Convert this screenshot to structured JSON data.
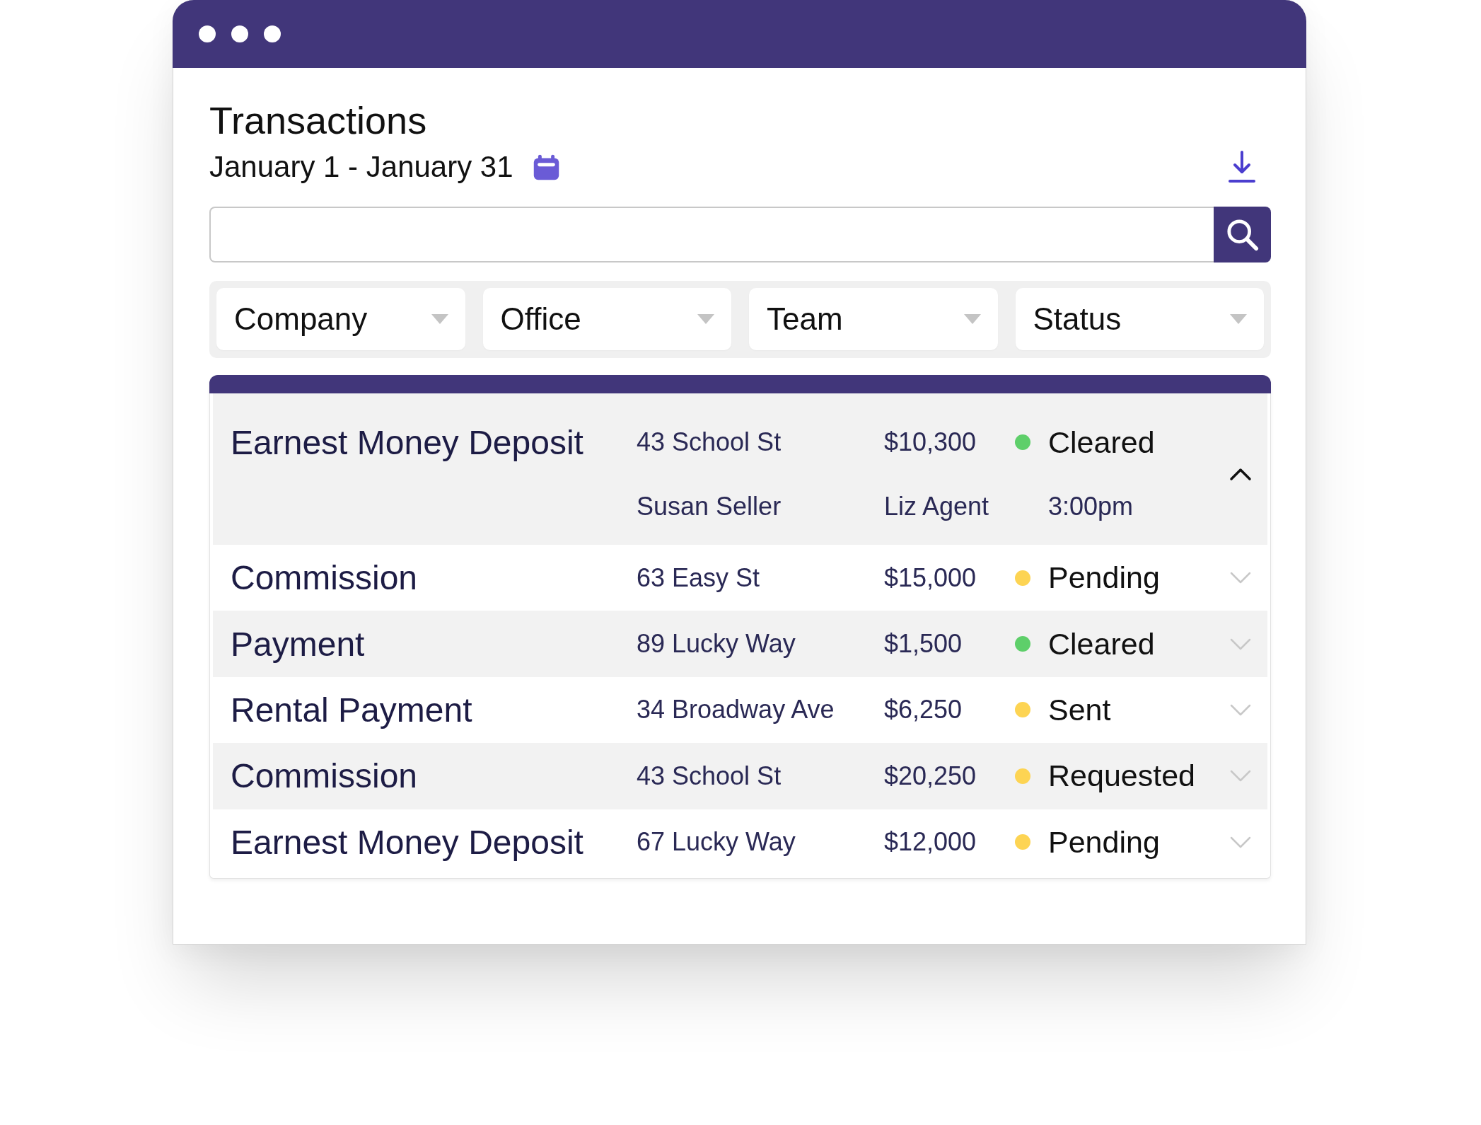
{
  "header": {
    "title": "Transactions",
    "date_range": "January 1 - January 31"
  },
  "filters": [
    "Company",
    "Office",
    "Team",
    "Status"
  ],
  "transactions": [
    {
      "type": "Earnest Money Deposit",
      "address": "43 School St",
      "amount": "$10,300",
      "status": "Cleared",
      "color": "#5ecf6a",
      "expanded": true,
      "details": {
        "party": "Susan Seller",
        "agent": "Liz Agent",
        "time": "3:00pm"
      }
    },
    {
      "type": "Commission",
      "address": "63 Easy St",
      "amount": "$15,000",
      "status": "Pending",
      "color": "#fdd453",
      "expanded": false
    },
    {
      "type": "Payment",
      "address": "89 Lucky Way",
      "amount": "$1,500",
      "status": "Cleared",
      "color": "#5ecf6a",
      "expanded": false
    },
    {
      "type": "Rental Payment",
      "address": "34 Broadway Ave",
      "amount": "$6,250",
      "status": "Sent",
      "color": "#fdd453",
      "expanded": false
    },
    {
      "type": "Commission",
      "address": "43 School St",
      "amount": "$20,250",
      "status": "Requested",
      "color": "#fdd453",
      "expanded": false
    },
    {
      "type": "Earnest Money Deposit",
      "address": "67 Lucky Way",
      "amount": "$12,000",
      "status": "Pending",
      "color": "#fdd453",
      "expanded": false
    }
  ]
}
